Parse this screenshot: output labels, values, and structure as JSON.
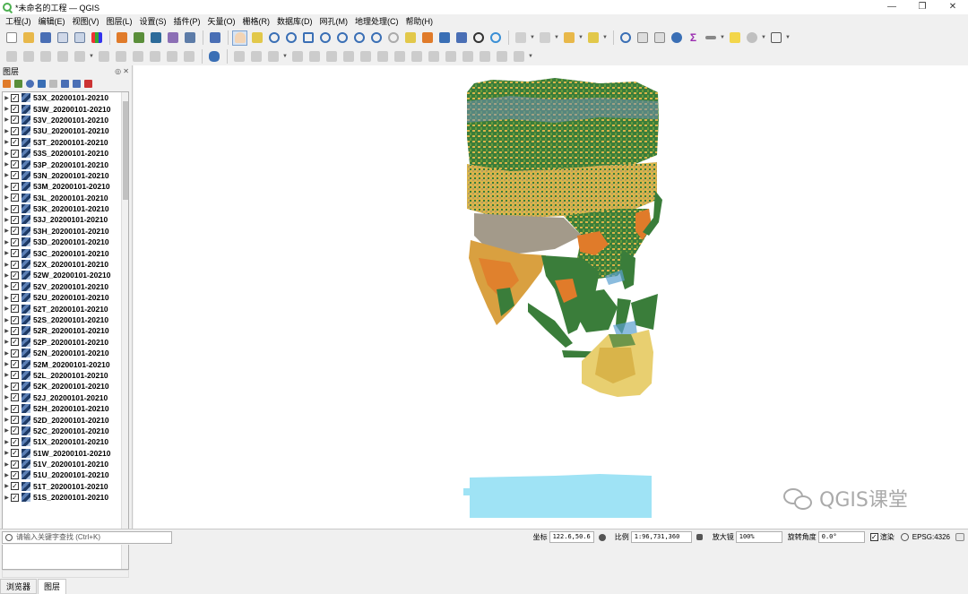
{
  "window": {
    "title": "*未命名的工程 — QGIS",
    "controls": [
      "—",
      "❐",
      "✕"
    ]
  },
  "menu": [
    "工程(J)",
    "编辑(E)",
    "视图(V)",
    "图层(L)",
    "设置(S)",
    "插件(P)",
    "矢量(O)",
    "栅格(R)",
    "数据库(D)",
    "网孔(M)",
    "地理处理(C)",
    "帮助(H)"
  ],
  "layers_panel": {
    "title": "图层",
    "controls": "◎ ✕",
    "layers": [
      "53X_20200101-20210",
      "53W_20200101-20210",
      "53V_20200101-20210",
      "53U_20200101-20210",
      "53T_20200101-20210",
      "53S_20200101-20210",
      "53P_20200101-20210",
      "53N_20200101-20210",
      "53M_20200101-20210",
      "53L_20200101-20210",
      "53K_20200101-20210",
      "53J_20200101-20210",
      "53H_20200101-20210",
      "53D_20200101-20210",
      "53C_20200101-20210",
      "52X_20200101-20210",
      "52W_20200101-20210",
      "52V_20200101-20210",
      "52U_20200101-20210",
      "52T_20200101-20210",
      "52S_20200101-20210",
      "52R_20200101-20210",
      "52P_20200101-20210",
      "52N_20200101-20210",
      "52M_20200101-20210",
      "52L_20200101-20210",
      "52K_20200101-20210",
      "52J_20200101-20210",
      "52H_20200101-20210",
      "52D_20200101-20210",
      "52C_20200101-20210",
      "51X_20200101-20210",
      "51W_20200101-20210",
      "51V_20200101-20210",
      "51U_20200101-20210",
      "51T_20200101-20210",
      "51S_20200101-20210"
    ],
    "tabs": [
      "浏览器",
      "图层"
    ]
  },
  "statusbar": {
    "search_placeholder": "请输入关键字查找 (Ctrl+K)",
    "coord_label": "坐标",
    "coord_value": "122.6,50.6",
    "scale_label": "比例",
    "scale_value": "1:96,731,360",
    "magnifier_label": "放大镜",
    "magnifier_value": "100%",
    "rotation_label": "旋转角度",
    "rotation_value": "0.0°",
    "render_label": "渲染",
    "crs_label": "EPSG:4326"
  },
  "watermark": "QGIS课堂",
  "colors": {
    "forest": "#3a7d3a",
    "crop": "#d9b44a",
    "bare": "#a39a8a",
    "water": "#9fe3f5",
    "shrub": "#e07b2a"
  }
}
